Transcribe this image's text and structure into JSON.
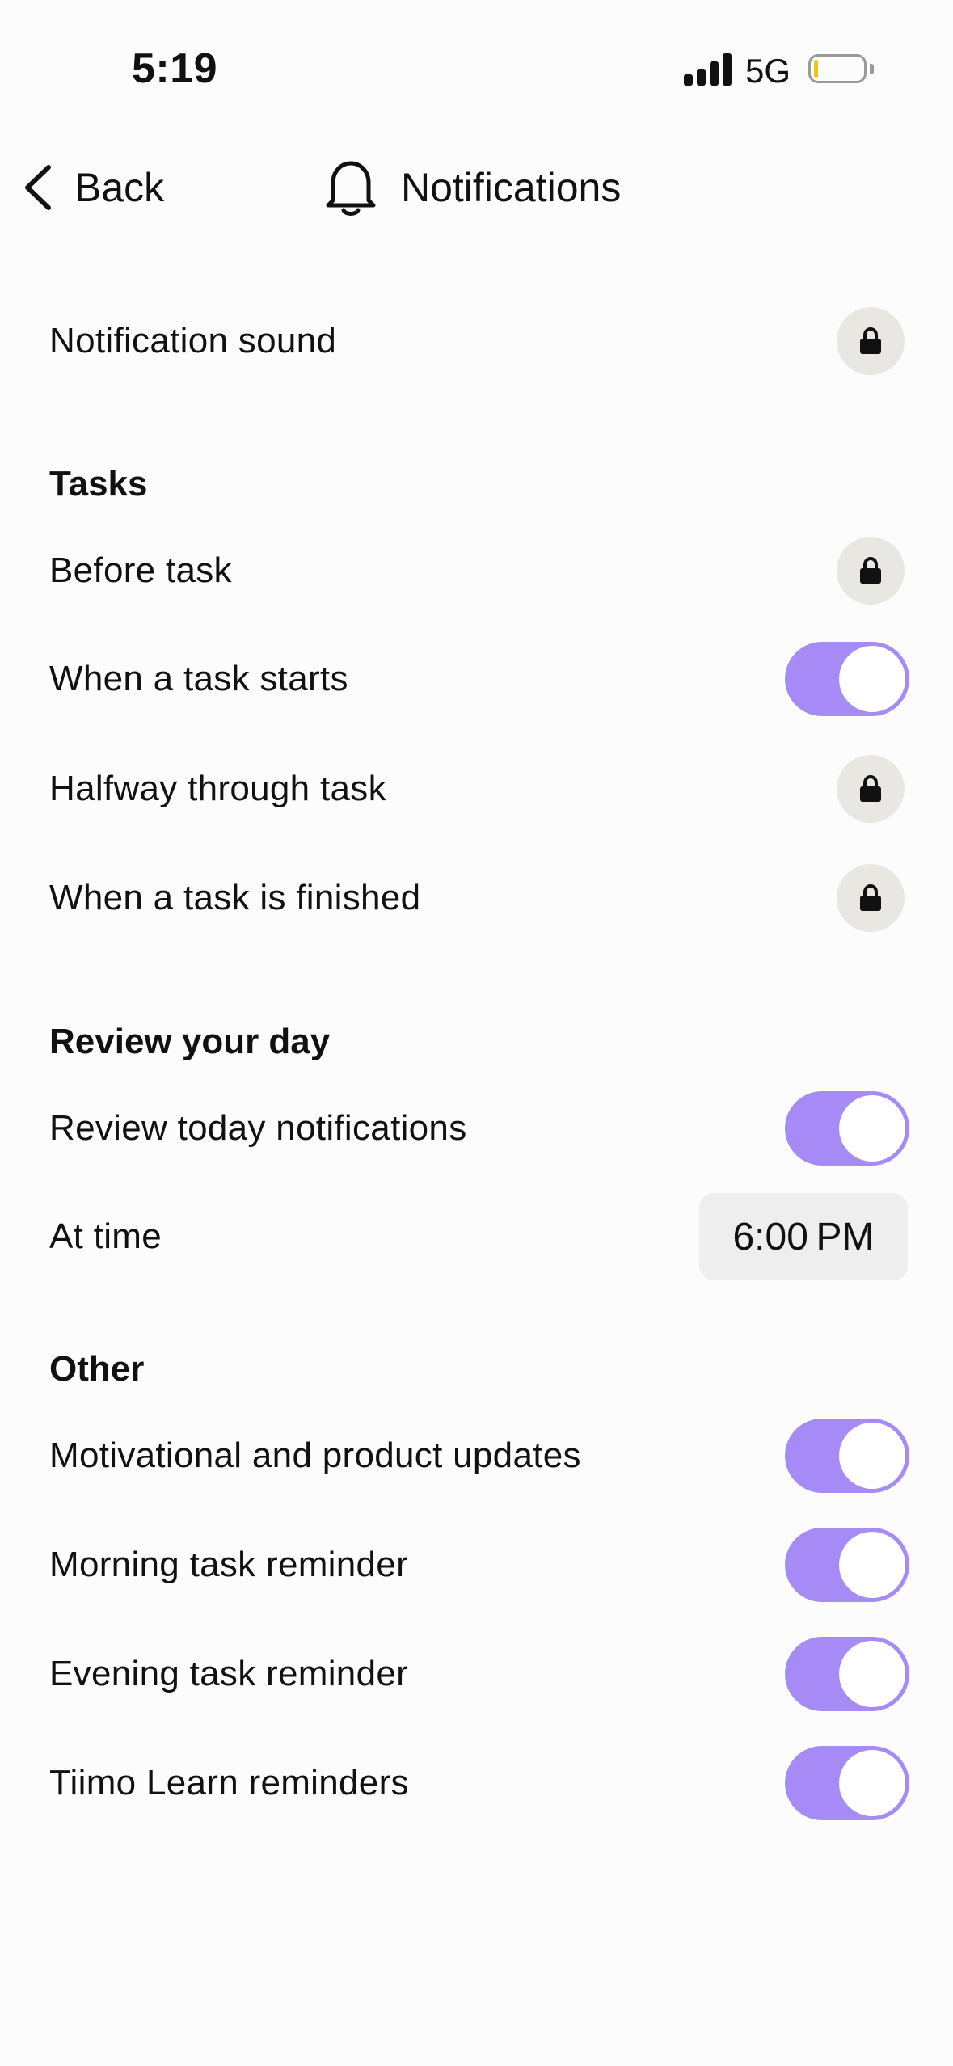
{
  "status_bar": {
    "time": "5:19",
    "network": "5G",
    "battery_level": 0.08,
    "battery_color": "#f1c40f"
  },
  "nav": {
    "back_label": "Back",
    "title": "Notifications",
    "back_icon": "chevron-left-icon",
    "title_icon": "bell-icon"
  },
  "general": {
    "notification_sound": {
      "label": "Notification sound",
      "state": "locked"
    }
  },
  "tasks": {
    "title": "Tasks",
    "items": [
      {
        "label": "Before task",
        "state": "locked"
      },
      {
        "label": "When a task starts",
        "state": "on"
      },
      {
        "label": "Halfway through task",
        "state": "locked"
      },
      {
        "label": "When a task is finished",
        "state": "locked"
      }
    ]
  },
  "review": {
    "title": "Review your day",
    "review_today": {
      "label": "Review today notifications",
      "state": "on"
    },
    "at_time": {
      "label": "At time",
      "value": "6:00 PM"
    }
  },
  "other": {
    "title": "Other",
    "items": [
      {
        "label": "Motivational and product updates",
        "state": "on"
      },
      {
        "label": "Morning task reminder",
        "state": "on"
      },
      {
        "label": "Evening task reminder",
        "state": "on"
      },
      {
        "label": "Tiimo Learn reminders",
        "state": "on"
      }
    ]
  },
  "colors": {
    "toggle_on": "#a68af6",
    "lock_badge": "#e9e7e2",
    "time_chip": "#eeeeef",
    "background": "#fcfcfc"
  }
}
